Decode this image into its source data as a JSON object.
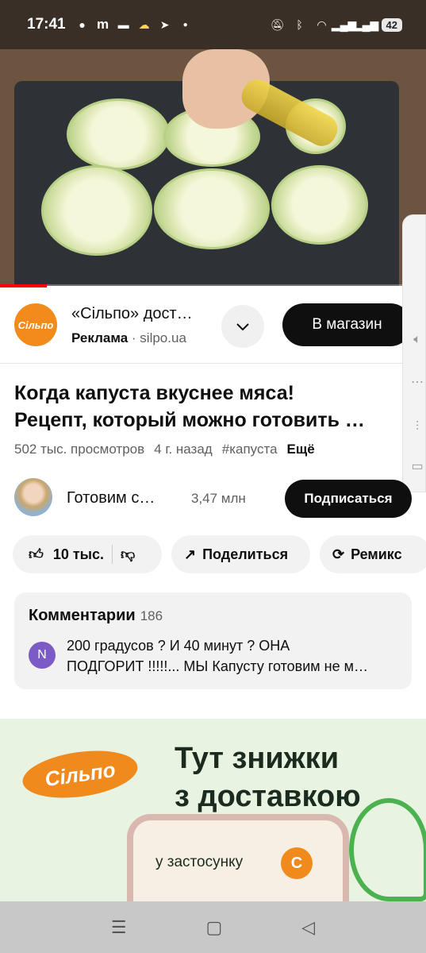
{
  "status_bar": {
    "time": "17:41",
    "battery": "42",
    "left_icons": [
      "chat-icon",
      "m-icon",
      "card-icon",
      "weather-icon",
      "telegram-icon",
      "dot-icon"
    ],
    "right_icons": [
      "mute-icon",
      "bluetooth-icon",
      "wifi-icon",
      "signal-icon",
      "signal-icon-2"
    ]
  },
  "video": {
    "progress_fraction": 0.11,
    "progress_color": "#ff0000"
  },
  "ad": {
    "title": "«Сільпо» дост…",
    "label": "Реклама",
    "separator": "·",
    "domain": "silpo.ua",
    "logo_text": "Сільпо",
    "cta": "В магазин",
    "brand_color": "#f28a1c"
  },
  "video_info": {
    "title_line1": "Когда капуста вкуснее мяса!",
    "title_line2": "Рецепт, который можно готовить …",
    "views": "502 тыс. просмотров",
    "age": "4 г. назад",
    "hashtag": "#капуста",
    "more": "Ещё"
  },
  "channel": {
    "name": "Готовим с…",
    "subscribers": "3,47 млн",
    "subscribe_label": "Подписаться"
  },
  "actions": {
    "likes": "10 тыс.",
    "share": "Поделиться",
    "remix": "Ремикс"
  },
  "comments": {
    "heading": "Комментарии",
    "count": "186",
    "top_avatar_letter": "N",
    "top_line1": "200 градусов ? И 40 минут ? ОНА",
    "top_line2": "ПОДГОРИТ !!!!!... МЫ Капусту готовим не м…"
  },
  "banner": {
    "logo_text": "Сільпо",
    "headline_line1": "Тут знижки",
    "headline_line2": "з доставкою",
    "app_text": "у застосунку",
    "app_logo_text": "С"
  },
  "navbar": {
    "icons": [
      "menu-icon",
      "home-icon",
      "back-icon"
    ]
  }
}
